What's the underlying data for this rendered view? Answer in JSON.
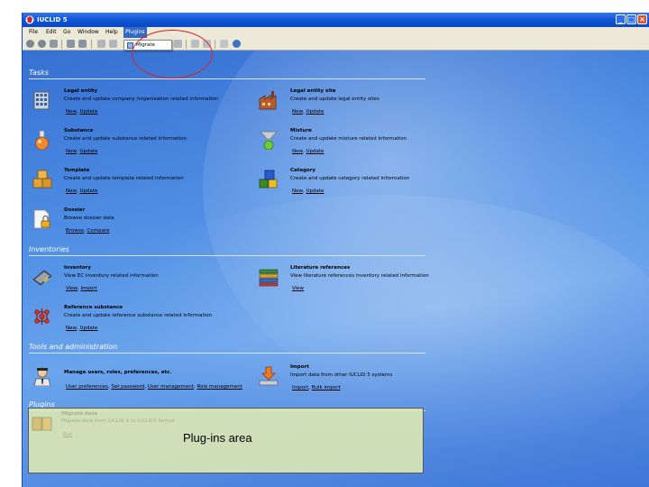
{
  "window": {
    "title": "IUCLID 5"
  },
  "menu": {
    "items": [
      "File",
      "Edit",
      "Go",
      "Window",
      "Help",
      "Plugins"
    ],
    "active": "Plugins",
    "dropdown": {
      "item": "Migrate",
      "icon": "migrate-icon"
    }
  },
  "sections": {
    "tasks": "Tasks",
    "inventories": "Inventories",
    "tools": "Tools and administration",
    "plugins": "Plugins"
  },
  "tasks": [
    {
      "title": "Legal entity",
      "desc": "Create and update company /organisation related information",
      "links": [
        "New",
        "Update"
      ],
      "icon": "building-icon"
    },
    {
      "title": "Legal entity site",
      "desc": "Create and update legal entity sites",
      "links": [
        "New",
        "Update"
      ],
      "icon": "factory-icon"
    },
    {
      "title": "Substance",
      "desc": "Create and update substance related information",
      "links": [
        "New",
        "Update"
      ],
      "icon": "flask-icon"
    },
    {
      "title": "Mixture",
      "desc": "Create and update mixture related information",
      "links": [
        "New",
        "Update"
      ],
      "icon": "mixture-icon"
    },
    {
      "title": "Template",
      "desc": "Create and update template related information",
      "links": [
        "New",
        "Update"
      ],
      "icon": "boxes-icon"
    },
    {
      "title": "Category",
      "desc": "Create and update category related information",
      "links": [
        "New",
        "Update"
      ],
      "icon": "cubes-icon"
    },
    {
      "title": "Dossier",
      "desc": "Browse dossier data",
      "links": [
        "Browse",
        "Compare"
      ],
      "icon": "dossier-lock-icon"
    }
  ],
  "inventories": [
    {
      "title": "Inventory",
      "desc": "View EC inventory related information",
      "links": [
        "View",
        "Import"
      ],
      "icon": "inventory-book-icon"
    },
    {
      "title": "Literature references",
      "desc": "View literature references inventory related information",
      "links": [
        "View"
      ],
      "icon": "books-icon"
    },
    {
      "title": "Reference substance",
      "desc": "Create and update reference substance related information",
      "links": [
        "New",
        "Update"
      ],
      "icon": "molecule-icon"
    }
  ],
  "tools": [
    {
      "title": "Manage users, roles, preferences, etc.",
      "desc": "",
      "links": [
        "User preferences",
        "Set password",
        "User management",
        "Role management"
      ],
      "icon": "user-admin-icon"
    },
    {
      "title": "Import",
      "desc": "Import data from other IUCLID 5 systems",
      "links": [
        "Import",
        "Bulk import"
      ],
      "icon": "import-icon"
    }
  ],
  "plugins_area": {
    "title": "Migrate data",
    "desc": "Migrate data from IUCLID 4 to IUCLID5 format",
    "link": "Run",
    "caption": "Plug-ins area"
  },
  "colors": {
    "highlight_circle": "#e02020",
    "plugins_area_bg": "#dce8b4",
    "desktop_blue": "#4f8ee4"
  }
}
